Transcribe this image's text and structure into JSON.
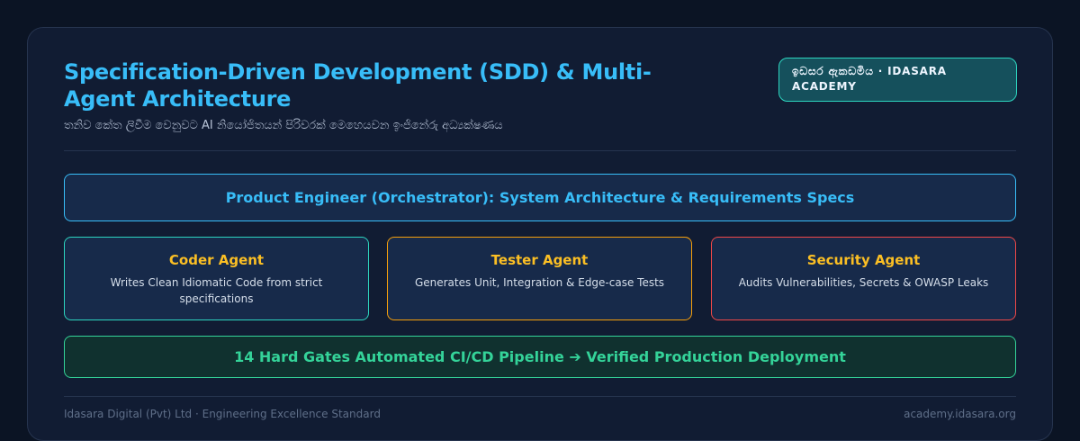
{
  "header": {
    "title": "Specification-Driven Development (SDD) & Multi-Agent Architecture",
    "subtitle": "තනිව කේත ලිවීම වෙනුවට AI නියෝජිතයන් පිරිවරක් මෙහෙයවන ඉංජිනේරු අධ්‍යක්ෂණය",
    "badge": "ඉඩසර ඇකඩමිය · IDASARA ACADEMY"
  },
  "orchestrator": {
    "label": "Product Engineer (Orchestrator): System Architecture & Requirements Specs"
  },
  "agents": [
    {
      "name": "Coder Agent",
      "desc": "Writes Clean Idiomatic Code from strict specifications",
      "accent": "#2dd4bf"
    },
    {
      "name": "Tester Agent",
      "desc": "Generates Unit, Integration & Edge-case Tests",
      "accent": "#f59e0b"
    },
    {
      "name": "Security Agent",
      "desc": "Audits Vulnerabilities, Secrets & OWASP Leaks",
      "accent": "#f04848"
    }
  ],
  "pipeline": {
    "label": "14 Hard Gates Automated CI/CD Pipeline ➔ Verified Production Deployment"
  },
  "footer": {
    "left": "Idasara Digital (Pvt) Ltd · Engineering Excellence Standard",
    "right": "academy.idasara.org"
  },
  "colors": {
    "title": "#38bdf8",
    "agent_name": "#fbbf24",
    "pipeline": "#34d399"
  }
}
